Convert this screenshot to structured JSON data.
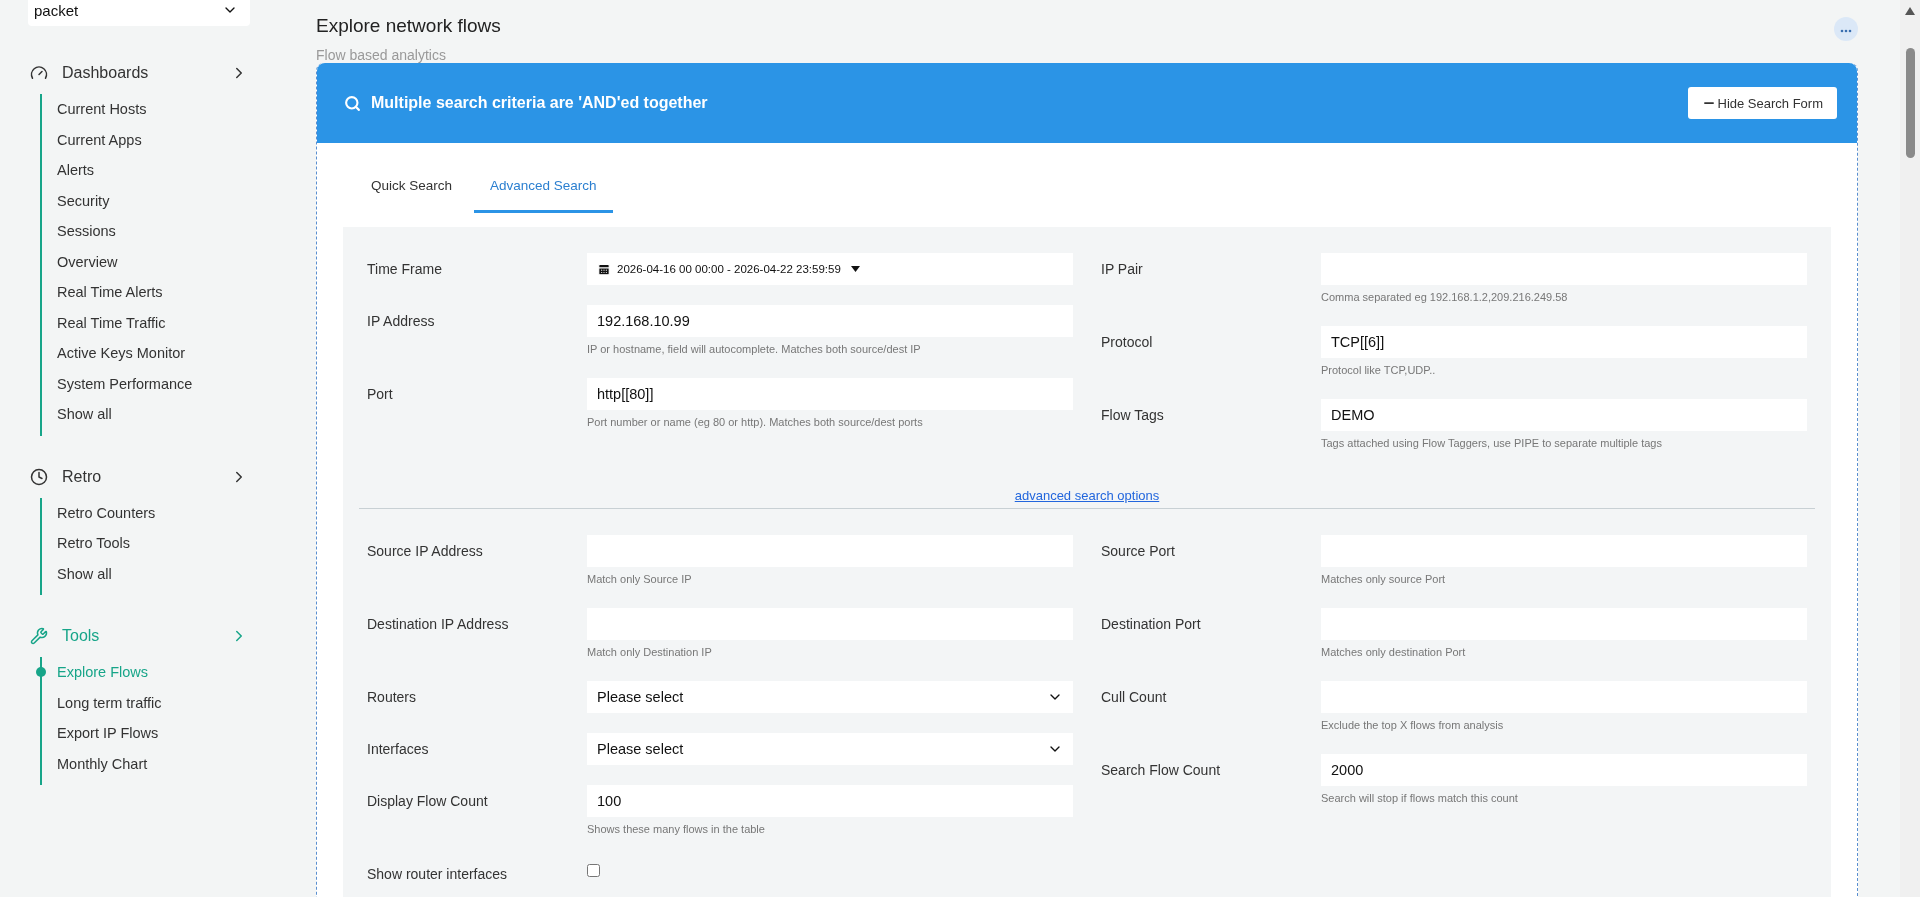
{
  "sidebar": {
    "selector": {
      "value": "packet"
    },
    "sections": [
      {
        "title": "Dashboards",
        "active": false,
        "items": [
          {
            "label": "Current Hosts",
            "selected": false
          },
          {
            "label": "Current Apps",
            "selected": false
          },
          {
            "label": "Alerts",
            "selected": false
          },
          {
            "label": "Security",
            "selected": false
          },
          {
            "label": "Sessions",
            "selected": false
          },
          {
            "label": "Overview",
            "selected": false
          },
          {
            "label": "Real Time Alerts",
            "selected": false
          },
          {
            "label": "Real Time Traffic",
            "selected": false
          },
          {
            "label": "Active Keys Monitor",
            "selected": false
          },
          {
            "label": "System Performance",
            "selected": false
          },
          {
            "label": "Show all",
            "selected": false
          }
        ]
      },
      {
        "title": "Retro",
        "active": false,
        "items": [
          {
            "label": "Retro Counters",
            "selected": false
          },
          {
            "label": "Retro Tools",
            "selected": false
          },
          {
            "label": "Show all",
            "selected": false
          }
        ]
      },
      {
        "title": "Tools",
        "active": true,
        "items": [
          {
            "label": "Explore Flows",
            "selected": true
          },
          {
            "label": "Long term traffic",
            "selected": false
          },
          {
            "label": "Export IP Flows",
            "selected": false
          },
          {
            "label": "Monthly Chart",
            "selected": false
          }
        ]
      }
    ]
  },
  "header": {
    "title": "Explore network flows",
    "subtitle": "Flow based analytics"
  },
  "search_card": {
    "banner": "Multiple search criteria are 'AND'ed together",
    "hide_button": "Hide Search Form",
    "tabs": [
      {
        "label": "Quick Search",
        "selected": false
      },
      {
        "label": "Advanced Search",
        "selected": true
      }
    ],
    "basic_fields": {
      "left": [
        {
          "kind": "date",
          "label": "Time Frame",
          "value": "2026-04-16 00 00:00 - 2026-04-22 23:59:59"
        },
        {
          "kind": "text",
          "label": "IP Address",
          "value": "192.168.10.99",
          "hint": "IP or hostname, field will autocomplete. Matches both source/dest IP"
        },
        {
          "kind": "text",
          "label": "Port",
          "value": "http[[80]]",
          "hint": "Port number or name (eg 80 or http). Matches both source/dest ports"
        }
      ],
      "right": [
        {
          "kind": "text",
          "label": "IP Pair",
          "hint": "Comma separated eg 192.168.1.2,209.216.249.58"
        },
        {
          "kind": "text",
          "label": "Protocol",
          "value": "TCP[[6]]",
          "hint": "Protocol like TCP,UDP.."
        },
        {
          "kind": "text",
          "label": "Flow Tags",
          "value": "DEMO",
          "hint": "Tags attached using Flow Taggers, use PIPE to separate multiple tags"
        }
      ]
    },
    "advanced_link": "advanced search options",
    "advanced_fields": {
      "left": [
        {
          "kind": "text",
          "label": "Source IP Address",
          "hint": "Match only Source IP"
        },
        {
          "kind": "text",
          "label": "Destination IP Address",
          "hint": "Match only Destination IP"
        },
        {
          "kind": "select",
          "label": "Routers",
          "value": "Please select"
        },
        {
          "kind": "select",
          "label": "Interfaces",
          "value": "Please select"
        },
        {
          "kind": "text",
          "label": "Display Flow Count",
          "value": "100",
          "hint": "Shows these many flows in the table"
        },
        {
          "kind": "checkbox",
          "label": "Show router interfaces",
          "checked": false
        }
      ],
      "right": [
        {
          "kind": "text",
          "label": "Source Port",
          "hint": "Matches only source Port"
        },
        {
          "kind": "text",
          "label": "Destination Port",
          "hint": "Matches only destination Port"
        },
        {
          "kind": "text",
          "label": "Cull Count",
          "hint": "Exclude the top X flows from analysis"
        },
        {
          "kind": "text",
          "label": "Search Flow Count",
          "value": "2000",
          "hint": "Search will stop if flows match this count"
        }
      ]
    }
  }
}
